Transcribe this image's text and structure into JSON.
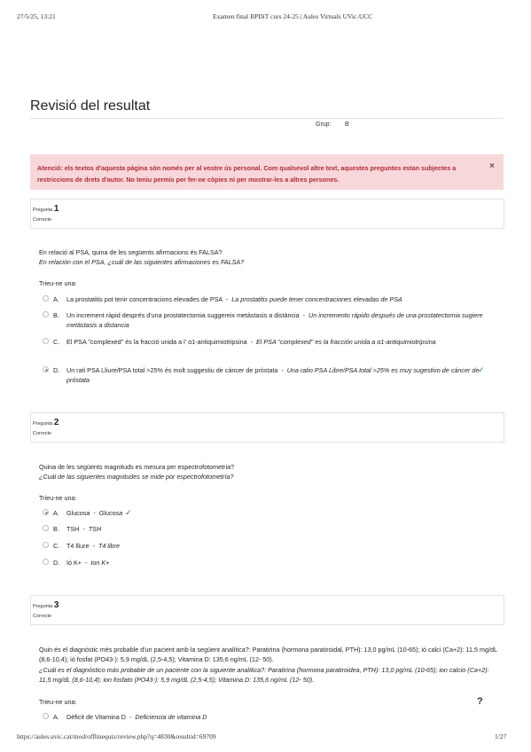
{
  "print_header": {
    "datetime": "27/5/25, 13:21",
    "doc_title": "Examen final BPDiT curs 24-25 | Aules Virtuals UVic-UCC"
  },
  "page": {
    "title": "Revisió del resultat",
    "group_label": "Grup:",
    "group_value": "B"
  },
  "alert": {
    "text": "Atenció: els textos d'aquesta pàgina són només per al vostre ús personal. Com qualsevol altre text, aquestes preguntes estan subjectes a restriccions de drets d'autor. No teniu permís per fer-ne còpies ni per mostrar-les a altres persones.",
    "close_symbol": "×"
  },
  "questions": [
    {
      "label": "Pregunta",
      "number": "1",
      "state": "Correcte",
      "text_ca": "En relació al PSA, quina de les següents afirmacions és FALSA?",
      "text_es": "En relación con el PSA, ¿cuál de las siguientes afirmaciones es FALSA?",
      "prompt": "Trieu-ne una:",
      "answers": [
        {
          "letter": "A.",
          "ca": "La prostatitis pot tenir concentracions elevades de PSA",
          "es": "La prostatitis puede tener concentraciones elevadas de PSA"
        },
        {
          "letter": "B.",
          "ca": "Un increment ràpid després d'una prostatectomia suggereix metàstasis a distància",
          "es": "Un incremento rápido después de una prostatectomia sugiere metástasis a distancia"
        },
        {
          "letter": "C.",
          "ca": "El PSA \"complexed\" és la fracció unida a l' α1-antiquimiotripsina",
          "es": "El PSA \"complexed\" es la fracción unida a α1-antiquimiotripsina"
        },
        {
          "letter": "D.",
          "ca": "Un rati PSA Lliure/PSA total >25% és molt suggestiu de càncer de pròstata",
          "es": "Una ratio PSA Libre/PSA total >25% es muy sugestivo de cáncer de próstata",
          "selected": true,
          "correct": true
        }
      ]
    },
    {
      "label": "Pregunta",
      "number": "2",
      "state": "Correcte",
      "text_ca": "Quina de les següents magnituds es mesura per espectrofotometria?",
      "text_es": "¿Cuál de las siguientes magnitudes se mide por espectrofotometría?",
      "prompt": "Trieu-ne una:",
      "answers": [
        {
          "letter": "A.",
          "ca": "Glucosa",
          "es": "Glucosa",
          "selected": true,
          "correct": true
        },
        {
          "letter": "B.",
          "ca": "TSH",
          "es": "TSH"
        },
        {
          "letter": "C.",
          "ca": "T4 lliure",
          "es": "T4 libre"
        },
        {
          "letter": "D.",
          "ca": "Ió K+",
          "es": "Ion K+"
        }
      ]
    },
    {
      "label": "Pregunta",
      "number": "3",
      "state": "Correcte",
      "text_ca": "Quin és el diagnòstic més probable d'un pacient amb la següent analítica?: Paratirina (hormona paratiroidal, PTH): 13,0 pg/mL (10-65); ió calci (Ca+2): 11,5 mg/dL (8,6-10,4); ió fosfat (PO43-): 5,9 mg/dL (2,5-4,5); Vitamina D: 135,6 ng/mL (12- 50).",
      "text_es": "¿Cuál es el diagnóstico más probable de un paciente con la siguiente analítica?: Paratirina (hormona paratiroidea, PTH): 13,0 pg/mL (10-65); ion calcio (Ca+2): 11,5 mg/dL (8,6-10,4); ion fosfato (PO43-): 5,9 mg/dL (2,5-4,5); Vitamina D: 135,6 ng/mL (12- 50).",
      "prompt": "Trieu-ne una:",
      "help_symbol": "?",
      "answers": [
        {
          "letter": "A.",
          "ca": "Dèficit de Vitamina D",
          "es": "Deficiencia de vitamina D"
        }
      ]
    }
  ],
  "print_footer": {
    "url": "https://aules.uvic.cat/mod/offlinequiz/review.php?q=4830&resultid=69709",
    "page": "1/27"
  },
  "colors": {
    "alert_bg": "#f8d7da",
    "alert_text": "#b02a37",
    "correct_tick": "#198754"
  },
  "icons": {
    "close": "close-icon",
    "correct": "check-icon",
    "help": "help-icon"
  }
}
